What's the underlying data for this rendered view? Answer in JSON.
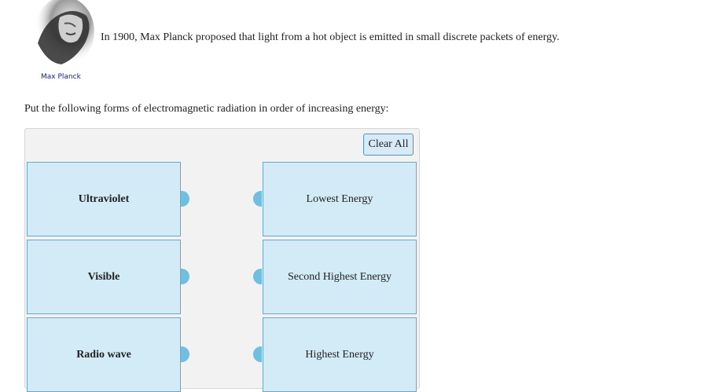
{
  "portrait": {
    "caption": "Max Planck"
  },
  "intro_text": "In 1900, Max Planck proposed that light from a hot object is emitted in small discrete packets of energy.",
  "question_text": "Put the following forms of electromagnetic radiation in order of increasing energy:",
  "clear_all_label": "Clear All",
  "items": [
    {
      "label": "Ultraviolet"
    },
    {
      "label": "Visible"
    },
    {
      "label": "Radio wave"
    }
  ],
  "targets": [
    {
      "label": "Lowest Energy"
    },
    {
      "label": "Second Highest Energy"
    },
    {
      "label": "Highest Energy"
    }
  ],
  "colors": {
    "card_bg": "#d3eaf7",
    "card_border": "#6fa5c8",
    "connector": "#70bfe0",
    "panel_bg": "#f2f2f2"
  }
}
